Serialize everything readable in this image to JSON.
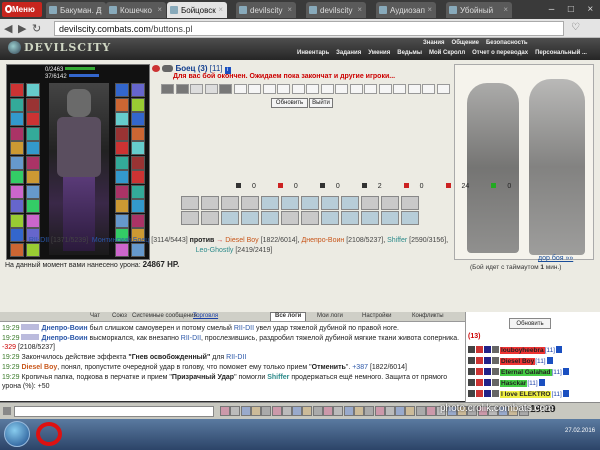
{
  "browser": {
    "menu_label": "Меню",
    "tabs": [
      {
        "label": "Бакуман. Д",
        "active": false
      },
      {
        "label": "Кошечко",
        "active": false
      },
      {
        "label": "Бойцовск",
        "active": true
      },
      {
        "label": "devilscity",
        "active": false
      },
      {
        "label": "devilscity",
        "active": false
      },
      {
        "label": "Аудиозап",
        "active": false
      },
      {
        "label": "Убойный",
        "active": false
      }
    ],
    "url_domain": "devilscity.combats.com",
    "url_path": "/buttons.pl"
  },
  "game": {
    "logo": "DEVILSCITY",
    "topnav_upper": [
      "Знания",
      "Общение",
      "Безопасность"
    ],
    "topnav_lower": [
      "Инвентарь",
      "Задания",
      "Умения",
      "Ведьмы",
      "Мой Скролл",
      "Отчет о переводах",
      "Персональный ..."
    ],
    "hp": "0/2463",
    "mana": "37/6142",
    "fighter_name": "Боец",
    "fighter_count": "(3)",
    "fighter_level": "[11]",
    "turn_message": "Для вас бой окончен. Ожидаем пока закончат и другие игроки...",
    "refresh_label": "Обновить",
    "exit_label": "Выйти",
    "stats": [
      "0",
      "0",
      "0",
      "2",
      "0",
      "24",
      "0"
    ],
    "vs_line": {
      "team1": [
        {
          "name": "RII-DII",
          "info": "[1371/5239]"
        },
        {
          "name": "Монтинский Боец",
          "info": "[3114/5443]"
        }
      ],
      "versus": "против",
      "team2": [
        {
          "name": "Diesel Boy",
          "info": "[1822/6014]"
        },
        {
          "name": "Днепро-Воин",
          "info": "[2108/5237]"
        },
        {
          "name": "Shiffer",
          "info": "[2590/3156]"
        },
        {
          "name": "Leo-Ghostly",
          "info": "[2419/2419]"
        }
      ]
    },
    "next_fight": "дор боя »»",
    "damage_label": "На данный момент вами нанесено урона:",
    "damage_value": "24867 HP.",
    "timeout_prefix": "(Бой идет с таймаутом",
    "timeout_value": "1",
    "timeout_suffix": "мин.)"
  },
  "chat": {
    "tabs": [
      "Чат",
      "Союз",
      "Системные сообщения",
      "Торговля",
      "Все логи",
      "Мои логи",
      "Настройки",
      "Конфликты"
    ],
    "active_tab": "Все логи",
    "messages": [
      {
        "time": "19:29",
        "parts": [
          {
            "t": "Днепро-Воин",
            "c": "blue",
            "b": true
          },
          {
            "t": " был слишком самоуверен и потому смелый "
          },
          {
            "t": "RII-DII",
            "c": "blue"
          },
          {
            "t": " увел удар тяжелой дубиной по правой ноге."
          }
        ]
      },
      {
        "time": "19:29",
        "parts": [
          {
            "t": "Днепро-Воин",
            "c": "blue",
            "b": true
          },
          {
            "t": " высморкался, как внезапно "
          },
          {
            "t": "RII-DII",
            "c": "blue"
          },
          {
            "t": ", прослезившись, раздробил тяжелой дубиной мягкие ткани живота соперника. "
          },
          {
            "t": "-329",
            "c": "red"
          },
          {
            "t": " [2108/5237]"
          }
        ]
      },
      {
        "time": "19:29",
        "parts": [
          {
            "t": "Закончилось действие эффекта "
          },
          {
            "t": "\"Гнев освобожденный\"",
            "b": true
          },
          {
            "t": " для "
          },
          {
            "t": "RII-DII",
            "c": "blue"
          }
        ]
      },
      {
        "time": "19:29",
        "parts": [
          {
            "t": "Diesel Boy",
            "c": "orange",
            "b": true
          },
          {
            "t": ", понял, пропустите очередной удар в голову, что поможет ему только прием \""
          },
          {
            "t": "Отменить",
            "b": true
          },
          {
            "t": "\". "
          },
          {
            "t": "+387",
            "c": "blue"
          },
          {
            "t": " [1822/6014]"
          }
        ]
      },
      {
        "time": "19:29",
        "parts": [
          {
            "t": "Кропичья папка, подкова в перчатке и прием \""
          },
          {
            "t": "Призрачный Удар",
            "b": true
          },
          {
            "t": "\" помогли "
          },
          {
            "t": "Shiffer",
            "c": "teal",
            "b": true
          },
          {
            "t": " продержаться ещё немного. Защита от прямого урона (%): +50"
          }
        ]
      }
    ]
  },
  "online": {
    "refresh_label": "Обновить",
    "count": "(13)",
    "players": [
      {
        "name": "louboyheebra",
        "level": "[11]",
        "bg": "#e33"
      },
      {
        "name": "Diesel Boy",
        "level": "[11]",
        "bg": "#e33"
      },
      {
        "name": "Eternal Galahad",
        "level": "[11]",
        "bg": "#4c4"
      },
      {
        "name": "Hasckar",
        "level": "[11]",
        "bg": "#4c4"
      },
      {
        "name": "I love ELEKTRO",
        "level": "[11]",
        "bg": "#ee4"
      }
    ]
  },
  "bottom": {
    "clock": "19:29",
    "watermark": "photo.crolik.combats.com",
    "tray_date": "27.02.2016"
  }
}
